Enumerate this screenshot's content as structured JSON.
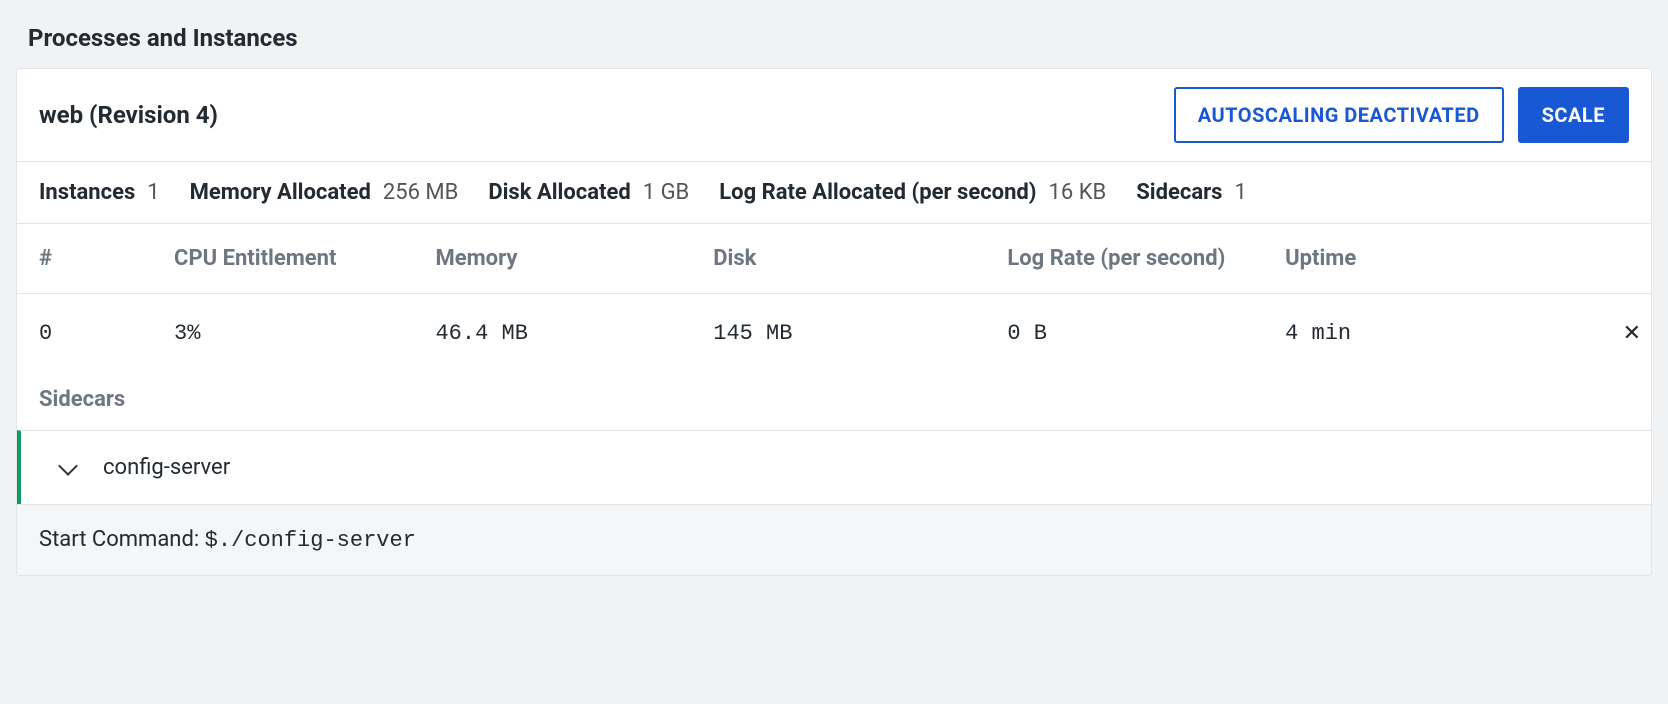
{
  "section": {
    "title": "Processes and Instances"
  },
  "header": {
    "title": "web (Revision 4)",
    "autoscaling_btn": "AUTOSCALING DEACTIVATED",
    "scale_btn": "SCALE"
  },
  "summary": {
    "instances_label": "Instances",
    "instances_value": "1",
    "memory_label": "Memory Allocated",
    "memory_value": "256 MB",
    "disk_label": "Disk Allocated",
    "disk_value": "1 GB",
    "lograte_label": "Log Rate Allocated (per second)",
    "lograte_value": "16 KB",
    "sidecars_label": "Sidecars",
    "sidecars_value": "1"
  },
  "table": {
    "headers": {
      "index": "#",
      "cpu": "CPU Entitlement",
      "memory": "Memory",
      "disk": "Disk",
      "lograte": "Log Rate (per second)",
      "uptime": "Uptime"
    },
    "rows": [
      {
        "index": "0",
        "cpu": "3%",
        "memory": "46.4 MB",
        "disk": "145 MB",
        "lograte": "0 B",
        "uptime": "4 min"
      }
    ]
  },
  "sidecars": {
    "heading": "Sidecars",
    "items": [
      {
        "name": "config-server"
      }
    ]
  },
  "start_command": {
    "label": "Start Command: ",
    "value": "$./config-server"
  }
}
